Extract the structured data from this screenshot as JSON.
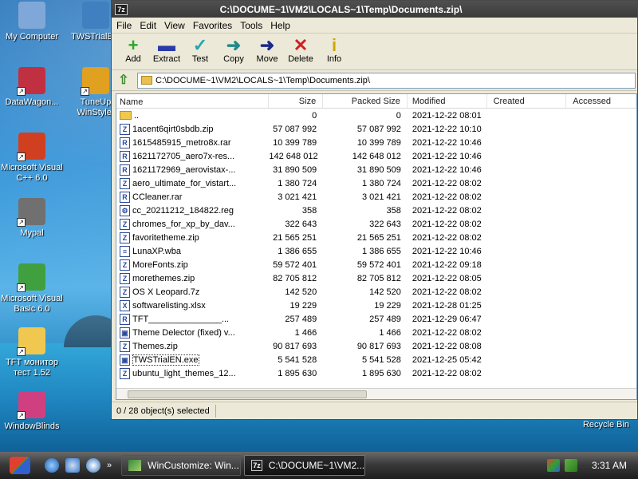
{
  "desktop": {
    "icons": [
      {
        "label": "My Computer",
        "icon": "computer-icon",
        "color": "#7fa8d8"
      },
      {
        "label": "DataWagon...",
        "icon": "datawagon-icon",
        "color": "#c03040"
      },
      {
        "label": "Microsoft Visual C++ 6.0",
        "icon": "visual-cpp-icon",
        "color": "#d04020"
      },
      {
        "label": "Mypal",
        "icon": "raccoon-icon",
        "color": "#707070"
      },
      {
        "label": "Microsoft Visual Basic 6.0",
        "icon": "visual-basic-icon",
        "color": "#40a040"
      },
      {
        "label": "TFT монитор тест 1.52",
        "icon": "folder-icon",
        "color": "#f0c850"
      },
      {
        "label": "WindowBlinds",
        "icon": "windowblinds-icon",
        "color": "#d04080"
      },
      {
        "label": "TWSTrialE...",
        "icon": "installer-icon",
        "color": "#4080c0"
      },
      {
        "label": "TuneUp WinStyler",
        "icon": "winstyler-icon",
        "color": "#e0a020"
      }
    ],
    "recycle_label": "Recycle Bin"
  },
  "window": {
    "title": "C:\\DOCUME~1\\VM2\\LOCALS~1\\Temp\\Documents.zip\\",
    "app_badge": "7z",
    "menu": [
      "File",
      "Edit",
      "View",
      "Favorites",
      "Tools",
      "Help"
    ],
    "toolbar": [
      {
        "label": "Add",
        "glyph": "+",
        "color": "#2aa82a",
        "icon": "add-icon"
      },
      {
        "label": "Extract",
        "glyph": "▬",
        "color": "#2a3aa8",
        "icon": "extract-icon"
      },
      {
        "label": "Test",
        "glyph": "✓",
        "color": "#20a8b0",
        "icon": "test-icon"
      },
      {
        "label": "Copy",
        "glyph": "➜",
        "color": "#208a8a",
        "icon": "copy-icon"
      },
      {
        "label": "Move",
        "glyph": "➜",
        "color": "#1a2a8a",
        "icon": "move-icon"
      },
      {
        "label": "Delete",
        "glyph": "✕",
        "color": "#d02020",
        "icon": "delete-icon"
      },
      {
        "label": "Info",
        "glyph": "i",
        "color": "#d0a800",
        "icon": "info-icon"
      }
    ],
    "address": "C:\\DOCUME~1\\VM2\\LOCALS~1\\Temp\\Documents.zip\\",
    "columns": [
      "Name",
      "Size",
      "Packed Size",
      "Modified",
      "Created",
      "Accessed"
    ],
    "files": [
      {
        "name": "..",
        "size": "0",
        "packed": "0",
        "modified": "2021-12-22 08:01",
        "type": "folder"
      },
      {
        "name": "1acent6qirt0sbdb.zip",
        "size": "57 087 992",
        "packed": "57 087 992",
        "modified": "2021-12-22 10:10",
        "type": "zip"
      },
      {
        "name": "1615485915_metro8x.rar",
        "size": "10 399 789",
        "packed": "10 399 789",
        "modified": "2021-12-22 10:46",
        "type": "rar"
      },
      {
        "name": "1621172705_aero7x-res...",
        "size": "142 648 012",
        "packed": "142 648 012",
        "modified": "2021-12-22 10:46",
        "type": "rar"
      },
      {
        "name": "1621172969_aerovistax-...",
        "size": "31 890 509",
        "packed": "31 890 509",
        "modified": "2021-12-22 10:46",
        "type": "rar"
      },
      {
        "name": "aero_ultimate_for_vistart...",
        "size": "1 380 724",
        "packed": "1 380 724",
        "modified": "2021-12-22 08:02",
        "type": "zip"
      },
      {
        "name": "CCleaner.rar",
        "size": "3 021 421",
        "packed": "3 021 421",
        "modified": "2021-12-22 08:02",
        "type": "rar"
      },
      {
        "name": "cc_20211212_184822.reg",
        "size": "358",
        "packed": "358",
        "modified": "2021-12-22 08:02",
        "type": "reg"
      },
      {
        "name": "chromes_for_xp_by_dav...",
        "size": "322 643",
        "packed": "322 643",
        "modified": "2021-12-22 08:02",
        "type": "zip"
      },
      {
        "name": "favoritetheme.zip",
        "size": "21 565 251",
        "packed": "21 565 251",
        "modified": "2021-12-22 08:02",
        "type": "zip"
      },
      {
        "name": "LunaXP.wba",
        "size": "1 386 655",
        "packed": "1 386 655",
        "modified": "2021-12-22 10:46",
        "type": "file"
      },
      {
        "name": "MoreFonts.zip",
        "size": "59 572 401",
        "packed": "59 572 401",
        "modified": "2021-12-22 09:18",
        "type": "zip"
      },
      {
        "name": "morethemes.zip",
        "size": "82 705 812",
        "packed": "82 705 812",
        "modified": "2021-12-22 08:05",
        "type": "zip"
      },
      {
        "name": "OS X Leopard.7z",
        "size": "142 520",
        "packed": "142 520",
        "modified": "2021-12-22 08:02",
        "type": "7z"
      },
      {
        "name": "softwarelisting.xlsx",
        "size": "19 229",
        "packed": "19 229",
        "modified": "2021-12-28 01:25",
        "type": "xlsx"
      },
      {
        "name": "TFT_______________...",
        "size": "257 489",
        "packed": "257 489",
        "modified": "2021-12-29 06:47",
        "type": "rar"
      },
      {
        "name": "Theme Delector (fixed) v...",
        "size": "1 466",
        "packed": "1 466",
        "modified": "2021-12-22 08:02",
        "type": "exe"
      },
      {
        "name": "Themes.zip",
        "size": "90 817 693",
        "packed": "90 817 693",
        "modified": "2021-12-22 08:08",
        "type": "zip"
      },
      {
        "name": "TWSTrialEN.exe",
        "size": "5 541 528",
        "packed": "5 541 528",
        "modified": "2021-12-25 05:42",
        "type": "exe",
        "selected": true
      },
      {
        "name": "ubuntu_light_themes_12...",
        "size": "1 895 630",
        "packed": "1 895 630",
        "modified": "2021-12-22 08:02",
        "type": "zip"
      }
    ],
    "status": "0 / 28 object(s) selected"
  },
  "taskbar": {
    "tasks": [
      {
        "label": "WinCustomize: Win...",
        "active": false,
        "icon": "wincustomize-icon"
      },
      {
        "label": "C:\\DOCUME~1\\VM2...",
        "active": true,
        "icon": "7zip-icon",
        "badge": "7z"
      }
    ],
    "overflow": "»",
    "clock": "3:31 AM"
  }
}
